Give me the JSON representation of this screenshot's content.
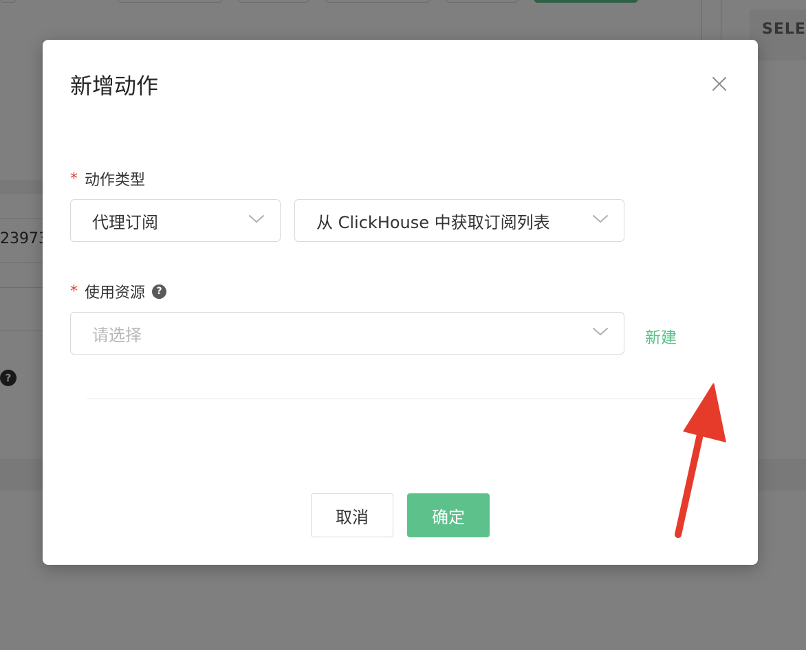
{
  "background": {
    "select_tab": "SELE",
    "cell_text": "23973"
  },
  "modal": {
    "title": "新增动作",
    "action_type": {
      "required_mark": "*",
      "label": "动作类型",
      "primary_value": "代理订阅",
      "secondary_value": "从 ClickHouse 中获取订阅列表"
    },
    "resource": {
      "required_mark": "*",
      "label": "使用资源",
      "help_icon": "?",
      "placeholder": "请选择",
      "new_link": "新建"
    },
    "buttons": {
      "cancel": "取消",
      "ok": "确定"
    }
  },
  "colors": {
    "accent": "#5cc18a",
    "required": "#e0392b",
    "annotation_arrow": "#e63b2a"
  }
}
